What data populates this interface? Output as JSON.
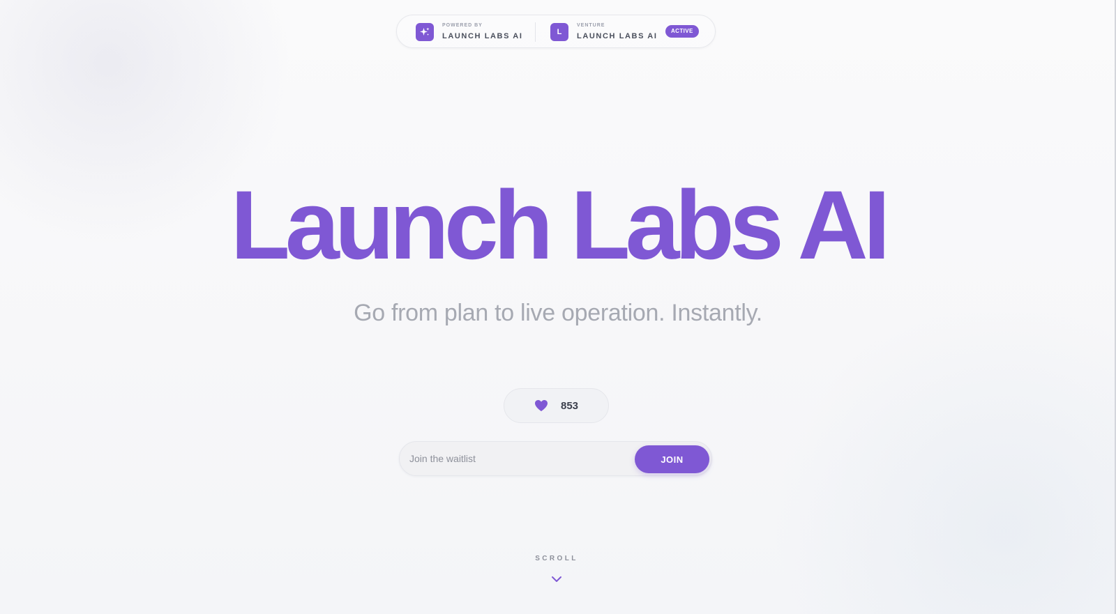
{
  "colors": {
    "accent": "#7f58d4",
    "subtitle": "#a6a9b2",
    "text": "#3b3f4c"
  },
  "header": {
    "powered": {
      "icon": "sparkle-icon",
      "kicker": "POWERED BY",
      "title": "LAUNCH LABS AI"
    },
    "venture": {
      "icon_letter": "L",
      "kicker": "VENTURE",
      "title": "LAUNCH LABS AI",
      "status": "ACTIVE"
    }
  },
  "hero": {
    "title": "Launch Labs AI",
    "subtitle": "Go from plan to live operation. Instantly."
  },
  "likes": {
    "icon": "heart-icon",
    "count": "853"
  },
  "waitlist": {
    "placeholder": "Join the waitlist",
    "value": "",
    "button_label": "JOIN"
  },
  "scroll": {
    "label": "SCROLL",
    "icon": "chevron-down-icon"
  }
}
